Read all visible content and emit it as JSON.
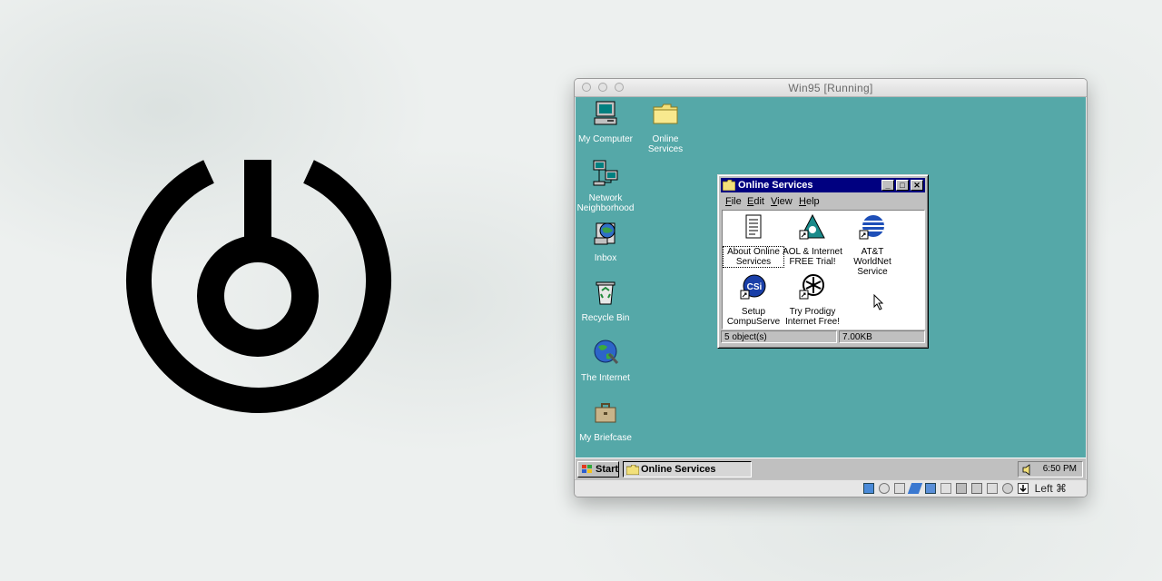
{
  "host_window": {
    "title": "Win95 [Running]"
  },
  "desktop": {
    "icons": [
      {
        "label_lines": [
          "My Computer"
        ],
        "icon": "computer-icon"
      },
      {
        "label_lines": [
          "Online",
          "Services"
        ],
        "icon": "folder-icon"
      },
      {
        "label_lines": [
          "Network",
          "Neighborhood"
        ],
        "icon": "network-icon"
      },
      {
        "label_lines": [
          "Inbox"
        ],
        "icon": "inbox-icon"
      },
      {
        "label_lines": [
          "Recycle Bin"
        ],
        "icon": "recycle-bin-icon"
      },
      {
        "label_lines": [
          "The Internet"
        ],
        "icon": "globe-icon"
      },
      {
        "label_lines": [
          "My Briefcase"
        ],
        "icon": "briefcase-icon"
      }
    ]
  },
  "explorer_window": {
    "title": "Online Services",
    "menu": [
      "File",
      "Edit",
      "View",
      "Help"
    ],
    "items": [
      {
        "label_lines": [
          "About Online",
          "Services"
        ],
        "icon": "document-icon",
        "selected": true
      },
      {
        "label_lines": [
          "AOL & Internet",
          "FREE Trial!"
        ],
        "icon": "aol-icon",
        "selected": false
      },
      {
        "label_lines": [
          "AT&T",
          "WorldNet",
          "Service"
        ],
        "icon": "att-icon",
        "selected": false
      },
      {
        "label_lines": [
          "Setup",
          "CompuServe"
        ],
        "icon": "compuserve-icon",
        "selected": false
      },
      {
        "label_lines": [
          "Try Prodigy",
          "Internet Free!"
        ],
        "icon": "prodigy-icon",
        "selected": false
      }
    ],
    "status": {
      "objects": "5 object(s)",
      "size": "7.00KB"
    }
  },
  "taskbar": {
    "start_label": "Start",
    "task_label": "Online Services",
    "clock": "6:50 PM"
  },
  "vbox_status": {
    "host_key": "Left ⌘"
  },
  "colors": {
    "desktop": "#55a8a8",
    "titlebar_active": "#000080",
    "win_face": "#c0c0c0"
  }
}
